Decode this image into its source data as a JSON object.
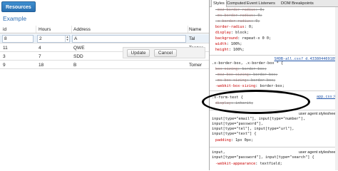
{
  "app": {
    "resources_button": "Resources",
    "title": "Example"
  },
  "grid": {
    "headers": [
      "id",
      "Hours",
      "Address",
      "Name"
    ],
    "edit_row": {
      "id": "8",
      "hours": "2",
      "address": "A",
      "name": "Tal"
    },
    "rows": [
      {
        "id": "11",
        "hours": "4",
        "address": "QWE",
        "name": "Tenzer"
      },
      {
        "id": "3",
        "hours": "7",
        "address": "SDD",
        "name": "Tomer"
      },
      {
        "id": "9",
        "hours": "18",
        "address": "B",
        "name": "Tomer"
      }
    ],
    "update_label": "Update",
    "cancel_label": "Cancel"
  },
  "devtools": {
    "tabs": [
      "Styles",
      "Computed",
      "Event Listeners",
      "DOM Breakpoints"
    ],
    "block1": {
      "lines": [
        {
          "prop": "-moz-border-radius",
          "val": "0;",
          "struck": true
        },
        {
          "prop": "-ms-border-radius",
          "val": "0;",
          "struck": true
        },
        {
          "prop": "-o-border-radius",
          "val": "0;",
          "struck": true
        },
        {
          "prop": "border-radius",
          "val": "0;",
          "struck": false
        },
        {
          "prop": "display",
          "val": "block;",
          "struck": false
        },
        {
          "prop": "background",
          "val": "repeat-x 0 0;",
          "struck": false
        },
        {
          "prop": "width",
          "val": "100%;",
          "struck": false
        },
        {
          "prop": "height",
          "val": "100%;",
          "struck": false
        }
      ]
    },
    "block2": {
      "selector": ".x-border-box, .x-border-box * {",
      "source": "SHOB-all.css?_d.433804469189",
      "lines": [
        {
          "prop": "box-sizing",
          "val": "border-box;",
          "struck": true
        },
        {
          "prop": "-moz-box-sizing",
          "val": "border-box;",
          "struck": true
        },
        {
          "prop": "-ms-box-sizing",
          "val": "border-box;",
          "struck": true
        },
        {
          "prop": "-webkit-box-sizing",
          "val": "border-box;",
          "struck": false
        }
      ]
    },
    "block3": {
      "selector": ".x-form-text {",
      "source": "app.css:6",
      "lines": [
        {
          "prop": "display",
          "val": "inherit;",
          "struck": true
        }
      ]
    },
    "block4": {
      "selector_lines": [
        "input[type=\"email\"], input[type=\"number\"],",
        "input[type=\"password\"],",
        "input[type=\"tel\"], input[type=\"url\"],",
        "input[type=\"text\"] {"
      ],
      "ua_label": "user agent stylesheet",
      "lines": [
        {
          "prop": "padding",
          "val": "1px 0px;",
          "struck": false
        }
      ]
    },
    "block5": {
      "selector_lines": [
        "input,",
        "input[type=\"password\"], input[type=\"search\"] {"
      ],
      "ua_label": "user agent stylesheet",
      "lines": [
        {
          "prop": "-webkit-appearance",
          "val": "textfield;",
          "struck": false
        }
      ]
    }
  }
}
